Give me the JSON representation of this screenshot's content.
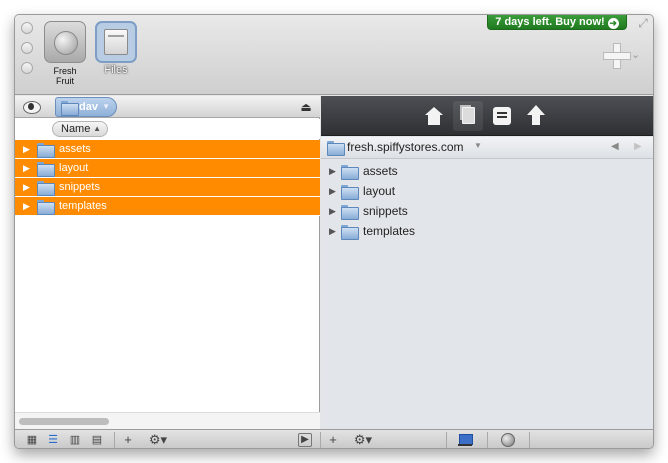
{
  "toolbar": {
    "favorites": [
      {
        "label": "Fresh\nFruit",
        "icon": "globe-server-icon"
      },
      {
        "label": "Files",
        "icon": "files-box-icon"
      }
    ],
    "trial_banner": "7 days left. Buy now!",
    "trial_color": "#2f8f2f"
  },
  "left_pane": {
    "path": "dav",
    "column_header": "Name",
    "items": [
      {
        "name": "assets"
      },
      {
        "name": "layout"
      },
      {
        "name": "snippets"
      },
      {
        "name": "templates"
      }
    ],
    "selection_color": "#ff8c00"
  },
  "right_pane": {
    "host": "fresh.spiffystores.com",
    "items": [
      {
        "name": "assets"
      },
      {
        "name": "layout"
      },
      {
        "name": "snippets"
      },
      {
        "name": "templates"
      }
    ],
    "toolbar_icons": [
      "home-icon",
      "documents-icon",
      "notes-icon",
      "upload-icon"
    ]
  }
}
